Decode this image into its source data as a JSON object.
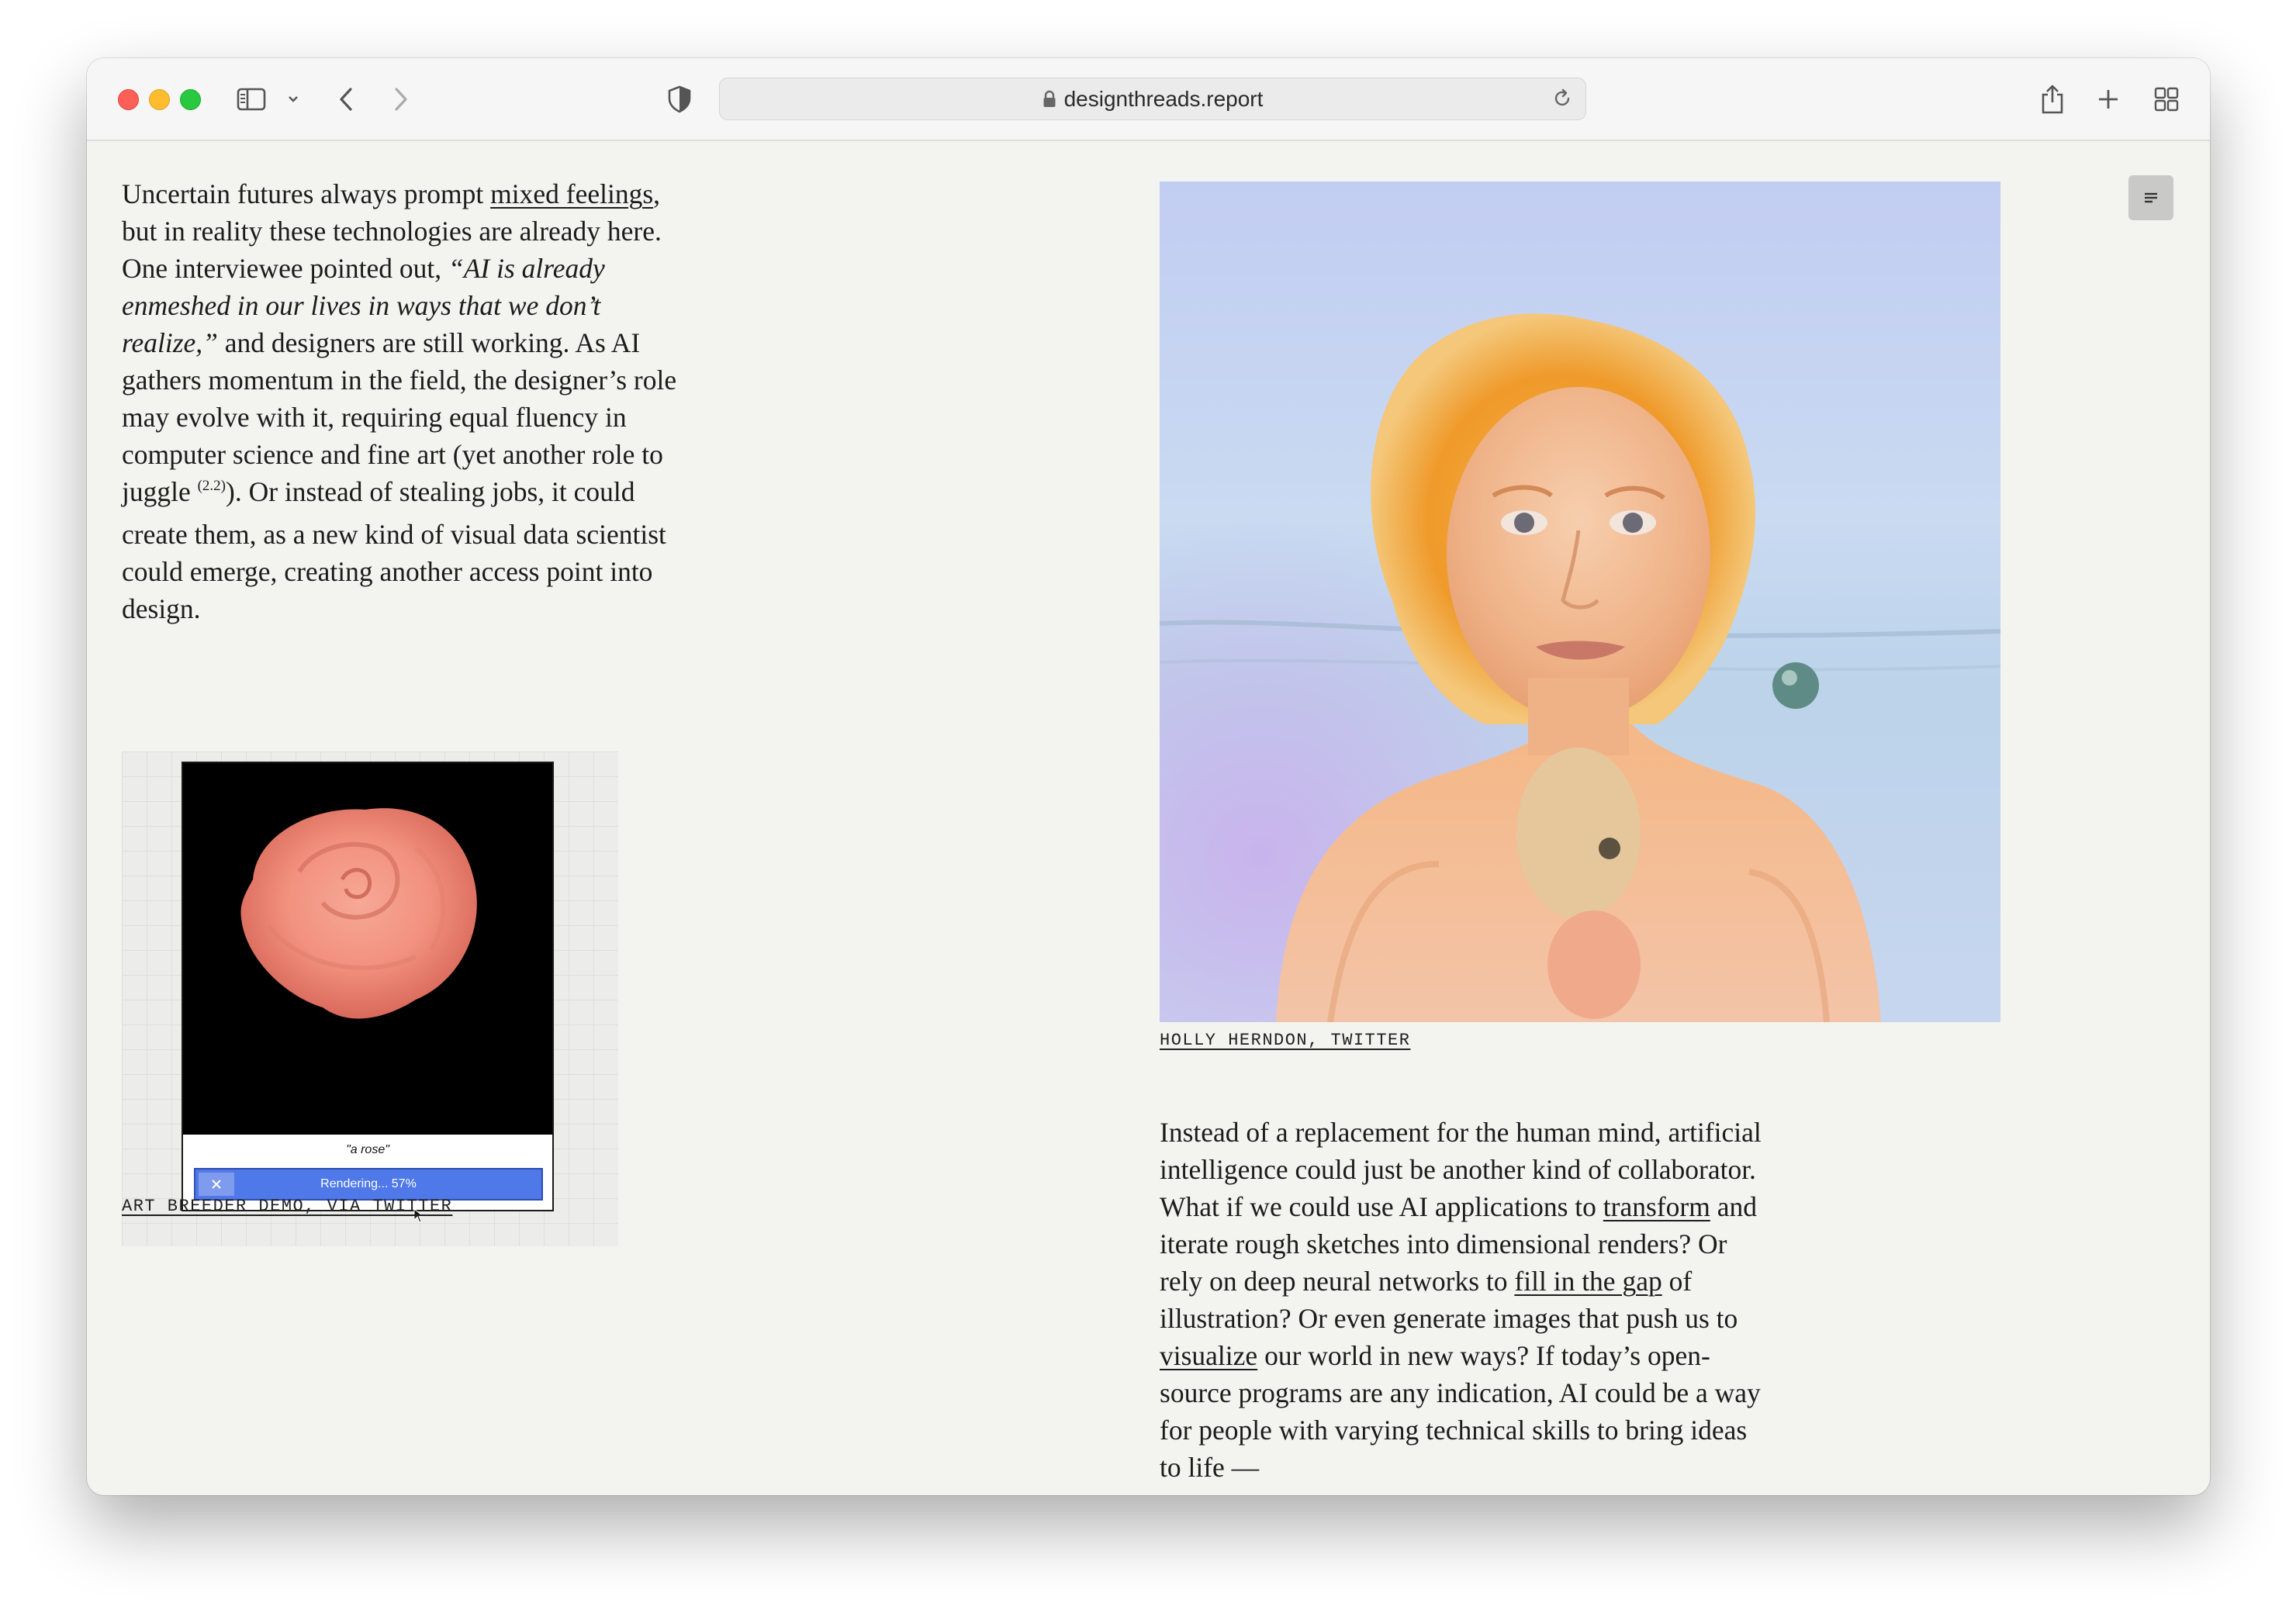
{
  "browser": {
    "url": "designthreads.report"
  },
  "article": {
    "para1": {
      "s1": "Uncertain futures always prompt ",
      "link1": "mixed feelings",
      "s2": ", but in reality these technologies are already here. One interviewee pointed out, ",
      "quote": "“AI is already enmeshed in our lives in ways that we don’t realize,”",
      "s3": " and designers are still working. As AI gathers momentum in the field, the designer’s role may evolve with it, requiring equal fluency in computer science and fine art (yet another role to juggle ",
      "footnote": "(2.2)",
      "s4": "). Or instead of stealing jobs, it could create them, as a new kind of visual data scientist could emerge, creating another access point into design."
    },
    "demo": {
      "prompt": "\"a rose\"",
      "progress_label": "Rendering... 57%",
      "progress": 0.57,
      "caption": "ART BREEDER DEMO, VIA TWITTER"
    },
    "portrait_caption": "HOLLY HERNDON, TWITTER",
    "para2": {
      "s1": "Instead of a replacement for the human mind, artificial intelligence could just be another kind of collaborator. What if we could use AI applications to ",
      "link1": "transform",
      "s2": " and iterate rough sketches into dimensional renders? Or rely on deep neural networks to ",
      "link2": "fill in the gap",
      "s3": " of illustration? Or even generate images that push us to ",
      "link3": "visualize",
      "s4": " our world in new ways? If today’s open-source programs are any indication, AI could be a way for people with varying technical skills to bring ideas to life —"
    }
  },
  "colors": {
    "page_bg": "#f3f3ef",
    "progress_blue": "#4f78e8",
    "rose": "#f2917e"
  },
  "icons": {
    "toolbar": [
      "sidebar-icon",
      "chevron-down-icon",
      "back-icon",
      "forward-icon",
      "privacy-shield-icon",
      "lock-icon",
      "reload-icon",
      "share-icon",
      "new-tab-icon",
      "tab-overview-icon"
    ],
    "content": [
      "reader-menu-icon",
      "close-icon",
      "cursor-icon"
    ]
  }
}
